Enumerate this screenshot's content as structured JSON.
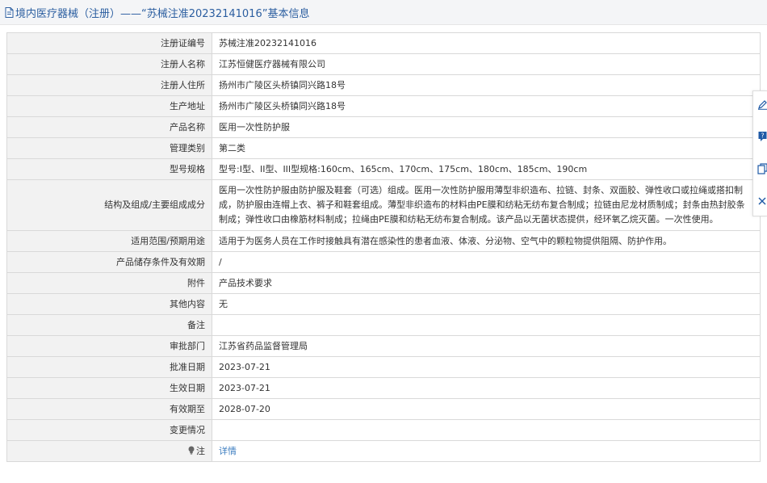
{
  "header": {
    "title": "境内医疗器械（注册）——“苏械注准20232141016”基本信息"
  },
  "rows": [
    {
      "label": "注册证编号",
      "value": "苏械注准20232141016"
    },
    {
      "label": "注册人名称",
      "value": "江苏恒健医疗器械有限公司"
    },
    {
      "label": "注册人住所",
      "value": "扬州市广陵区头桥镇同兴路18号"
    },
    {
      "label": "生产地址",
      "value": "扬州市广陵区头桥镇同兴路18号"
    },
    {
      "label": "产品名称",
      "value": "医用一次性防护服"
    },
    {
      "label": "管理类别",
      "value": "第二类"
    },
    {
      "label": "型号规格",
      "value": "型号:I型、II型、III型规格:160cm、165cm、170cm、175cm、180cm、185cm、190cm"
    },
    {
      "label": "结构及组成/主要组成成分",
      "value": "医用一次性防护服由防护服及鞋套（可选）组成。医用一次性防护服用薄型非织造布、拉链、封条、双面胶、弹性收口或拉绳或搭扣制成，防护服由连帽上衣、裤子和鞋套组成。薄型非织造布的材料由PE膜和纺粘无纺布复合制成；拉链由尼龙材质制成；封条由热封胶条制成；弹性收口由橡筋材料制成；拉绳由PE膜和纺粘无纺布复合制成。该产品以无菌状态提供，经环氧乙烷灭菌。一次性使用。"
    },
    {
      "label": "适用范围/预期用途",
      "value": "适用于为医务人员在工作时接触具有潜在感染性的患者血液、体液、分泌物、空气中的颗粒物提供阻隔、防护作用。"
    },
    {
      "label": "产品储存条件及有效期",
      "value": "/"
    },
    {
      "label": "附件",
      "value": "产品技术要求"
    },
    {
      "label": "其他内容",
      "value": "无"
    },
    {
      "label": "备注",
      "value": ""
    },
    {
      "label": "审批部门",
      "value": "江苏省药品监督管理局"
    },
    {
      "label": "批准日期",
      "value": "2023-07-21"
    },
    {
      "label": "生效日期",
      "value": "2023-07-21"
    },
    {
      "label": "有效期至",
      "value": "2028-07-20"
    },
    {
      "label": "变更情况",
      "value": ""
    }
  ],
  "note": {
    "label": "注",
    "link": "详情"
  },
  "colors": {
    "title": "#2b5ea0",
    "link": "#3d7ec0",
    "label_bg": "#f2f2f2",
    "border": "#d9d9d9"
  },
  "toolbar_icons": [
    "edit-icon",
    "help-icon",
    "copy-icon",
    "close-icon"
  ]
}
